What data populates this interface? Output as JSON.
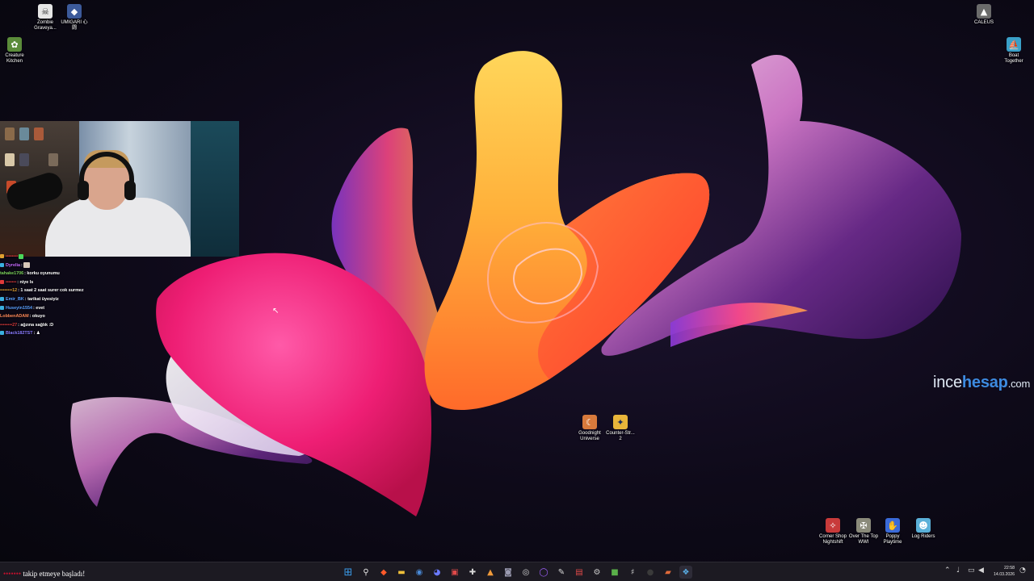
{
  "desktop": {
    "icons_top_left": [
      {
        "label": "Zombie\nGraveya...",
        "icon": "zombie-game-icon",
        "color": "#e6e6e6"
      },
      {
        "label": "UMIGARI 心\n闘",
        "icon": "umigari-game-icon",
        "color": "#3c5a9a"
      },
      {
        "label": "Creature\nKitchen",
        "icon": "creature-kitchen-icon",
        "color": "#5b8c3a"
      }
    ],
    "icons_top_right": [
      {
        "label": "CALEUS",
        "icon": "caleus-game-icon",
        "color": "#6b6b6b"
      },
      {
        "label": "Boat\nTogether",
        "icon": "boat-together-icon",
        "color": "#3aa0c8"
      }
    ],
    "icons_center": [
      {
        "label": "Goodnight\nUniverse",
        "icon": "goodnight-universe-icon",
        "color": "#d87a3c"
      },
      {
        "label": "Counter-Str...\n2",
        "icon": "counter-strike-icon",
        "color": "#e8b53a"
      }
    ],
    "icons_bottom_right": [
      {
        "label": "Corner Shop\nNightshift",
        "icon": "corner-shop-icon",
        "color": "#c83a3a"
      },
      {
        "label": "Over The Top\nWWI",
        "icon": "over-the-top-icon",
        "color": "#8a8a7a"
      },
      {
        "label": "Poppy\nPlaytime",
        "icon": "poppy-playtime-icon",
        "color": "#3a6ad8"
      },
      {
        "label": "Log Riders",
        "icon": "log-riders-icon",
        "color": "#5ab0d8"
      }
    ]
  },
  "chat": {
    "messages": [
      {
        "user": "••••••••",
        "text": "",
        "user_color": "#d93a3a",
        "badge_color": "#e0a030",
        "emote": true
      },
      {
        "user": "Dyrelia",
        "text": ":",
        "user_color": "#c86bff",
        "badge_color": "#3ab0e0",
        "emote": true
      },
      {
        "user": "tahake1706",
        "text": ": korku oyunumu",
        "user_color": "#7bd35a",
        "badge_color": "",
        "emote": false
      },
      {
        "user": "•••••••",
        "text": ": niye ls",
        "user_color": "#d93a3a",
        "badge_color": "#e03a3a",
        "emote": false
      },
      {
        "user": "••••••••12",
        "text": ": 1 saat 2 saat surer cok surmez",
        "user_color": "#e0a030",
        "badge_color": "",
        "emote": false
      },
      {
        "user": "Emir_BK",
        "text": ": tarikat üyesiyiz",
        "user_color": "#5aa0ff",
        "badge_color": "#3ab0e0",
        "emote": false
      },
      {
        "user": "Huseyin1554",
        "text": ": evet",
        "user_color": "#5aa0ff",
        "badge_color": "#3ab0e0",
        "emote": false
      },
      {
        "user": "LobbenADAM",
        "text": ": okuyo",
        "user_color": "#ff8a5a",
        "badge_color": "",
        "emote": false
      },
      {
        "user": "••••••••27",
        "text": ": ağzına sağlık :D",
        "user_color": "#d93a3a",
        "badge_color": "",
        "emote": false
      },
      {
        "user": "Black182TST",
        "text": ":",
        "user_color": "#8a7bff",
        "badge_color": "#3ab0e0",
        "emote": true
      }
    ]
  },
  "watermark": {
    "part1": "ince",
    "part2": "hesap",
    "part3": ".com"
  },
  "follow_alert": {
    "user": "•••••••",
    "text": " takip etmeye başladı!"
  },
  "taskbar": {
    "icons": [
      {
        "name": "start-button",
        "glyph": "⊞",
        "color": "#3a9ae8"
      },
      {
        "name": "search-icon",
        "glyph": "⚲",
        "color": "#e8e8e8"
      },
      {
        "name": "brave-browser-icon",
        "glyph": "◆",
        "color": "#ff5a2a"
      },
      {
        "name": "file-explorer-icon",
        "glyph": "▬",
        "color": "#f0c03a"
      },
      {
        "name": "steam-icon",
        "glyph": "◉",
        "color": "#4a8ad8"
      },
      {
        "name": "discord-icon",
        "glyph": "◕",
        "color": "#6a7aff"
      },
      {
        "name": "app-red-icon",
        "glyph": "▣",
        "color": "#e04a4a"
      },
      {
        "name": "epic-games-icon",
        "glyph": "✚",
        "color": "#d8d8d8"
      },
      {
        "name": "affinity-icon",
        "glyph": "▲",
        "color": "#f09a3a"
      },
      {
        "name": "vpn-icon",
        "glyph": "◙",
        "color": "#9a9ab0"
      },
      {
        "name": "obs-icon",
        "glyph": "◎",
        "color": "#d8d8d8"
      },
      {
        "name": "twitch-icon",
        "glyph": "◯",
        "color": "#a060ff"
      },
      {
        "name": "feather-icon",
        "glyph": "✎",
        "color": "#d8d8d8"
      },
      {
        "name": "pdf-icon",
        "glyph": "▤",
        "color": "#e04a4a"
      },
      {
        "name": "settings-icon",
        "glyph": "⚙",
        "color": "#c8c8c8"
      },
      {
        "name": "minecraft-icon",
        "glyph": "■",
        "color": "#5ab04a"
      },
      {
        "name": "tools-icon",
        "glyph": "♯",
        "color": "#c8c8c8"
      },
      {
        "name": "ghost-icon",
        "glyph": "●",
        "color": "#3a3a3a"
      },
      {
        "name": "terminal-icon",
        "glyph": "▰",
        "color": "#e06a3a"
      },
      {
        "name": "active-app-icon",
        "glyph": "❖",
        "color": "#5ab0e8"
      }
    ],
    "tray": [
      {
        "name": "tray-chevron-icon",
        "glyph": "⌃"
      },
      {
        "name": "microphone-icon",
        "glyph": "♩"
      },
      {
        "name": "volume-icon",
        "glyph": "◀"
      },
      {
        "name": "network-icon",
        "glyph": "▭"
      },
      {
        "name": "speaker-icon",
        "glyph": "♪"
      }
    ],
    "time": "22:58",
    "date": "14.03.2026",
    "notification_glyph": "🔔"
  }
}
